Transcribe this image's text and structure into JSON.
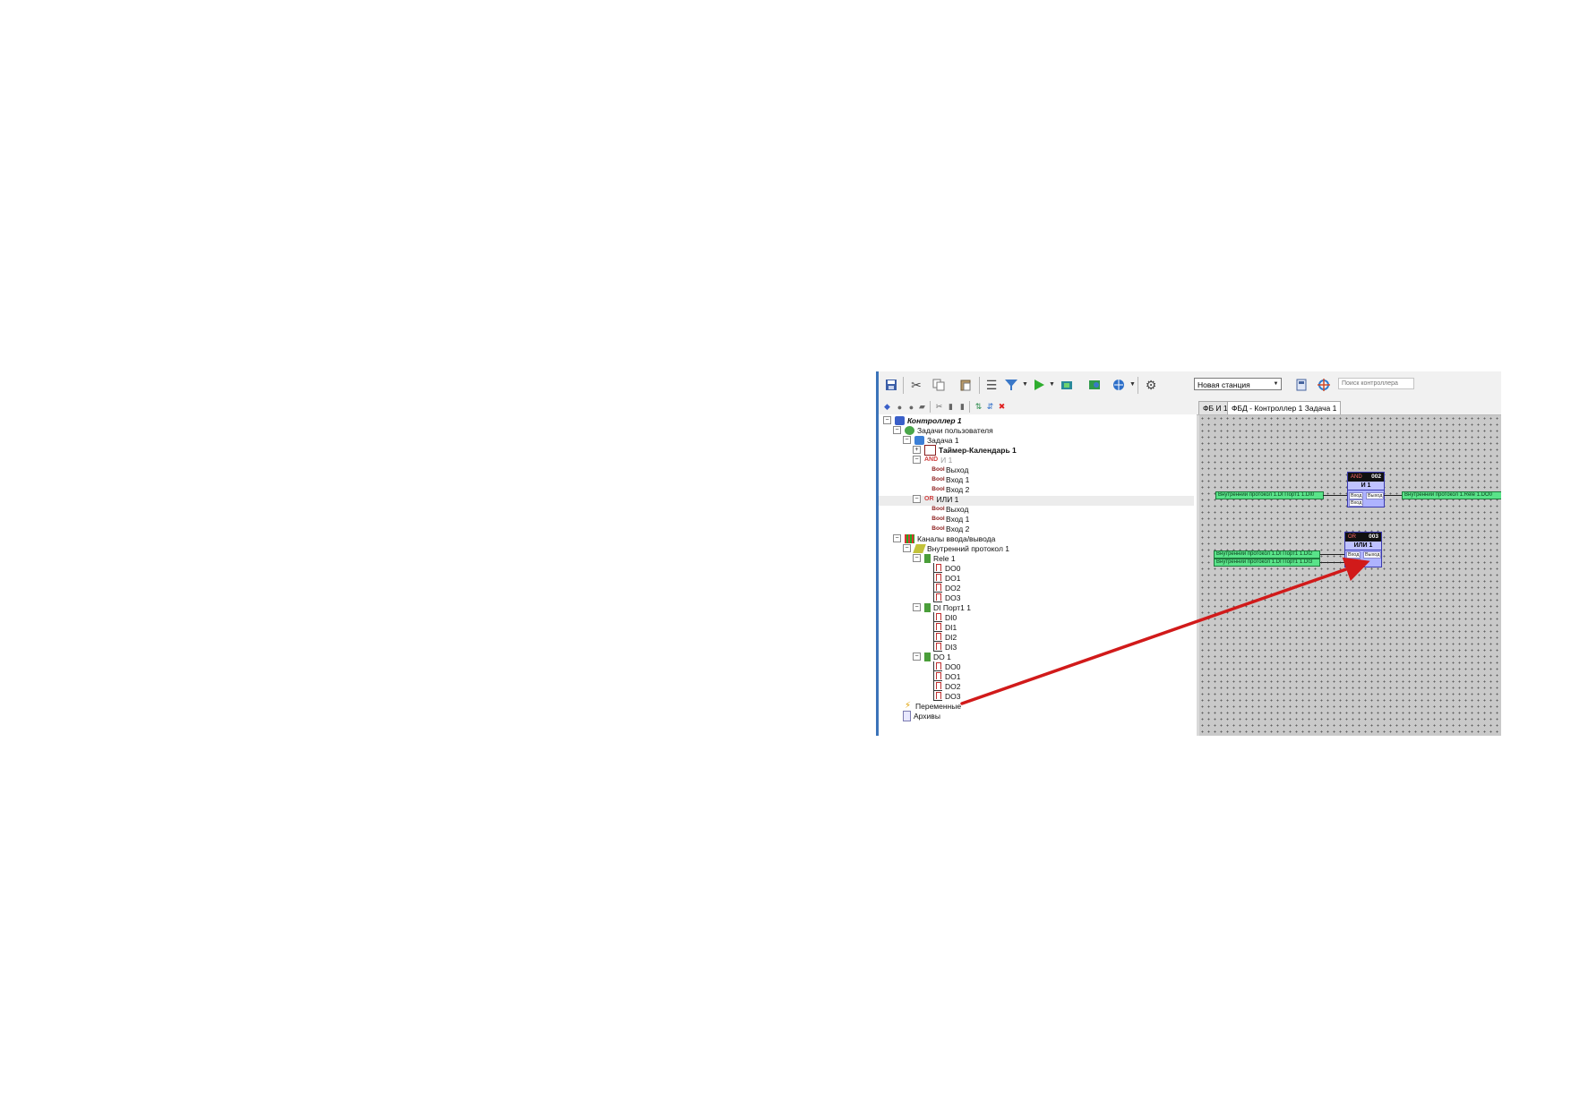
{
  "toolbar": {
    "station_selected": "Новая станция",
    "search_placeholder": "Поиск контроллера"
  },
  "tabs": [
    {
      "label": "ФБ И 1",
      "active": false
    },
    {
      "label": "ФБД - Контроллер 1 Задача 1",
      "active": true
    }
  ],
  "tree": {
    "controller": "Контроллер 1",
    "user_tasks": "Задачи пользователя",
    "task": "Задача 1",
    "timer": "Таймер-Календарь 1",
    "and_block": {
      "label": "И 1",
      "tag": "AND",
      "pins": [
        "Выход",
        "Вход 1",
        "Вход 2"
      ]
    },
    "or_block": {
      "label": "ИЛИ 1",
      "tag": "OR",
      "pins": [
        "Выход",
        "Вход 1",
        "Вход 2"
      ]
    },
    "io_channels": "Каналы ввода/вывода",
    "protocol": "Внутренний протокол 1",
    "rele": {
      "label": "Rele 1",
      "channels": [
        "DO0",
        "DO1",
        "DO2",
        "DO3"
      ]
    },
    "di_port": {
      "label": "DI Порт1 1",
      "channels": [
        "DI0",
        "DI1",
        "DI2",
        "DI3"
      ]
    },
    "do": {
      "label": "DO 1",
      "channels": [
        "DO0",
        "DO1",
        "DO2",
        "DO3"
      ]
    },
    "variables": "Переменные",
    "archives": "Архивы",
    "bool_icon": "Bool"
  },
  "canvas": {
    "and_block": {
      "id": "002",
      "type": "AND",
      "name": "И 1",
      "pin_in": "Вход",
      "pin_in2": "Вход",
      "pin_out": "Выход"
    },
    "or_block": {
      "id": "003",
      "type": "OR",
      "name": "ИЛИ 1",
      "pin_in": "Вход",
      "pin_in2": "Вход",
      "pin_out": "Выход"
    },
    "vars": {
      "and_in": "Внутренний протокол 1.DI Порт1 1.DI0",
      "and_out": "Внутренний протокол 1.Rele 1.DO0",
      "or_in1": "Внутренний протокол 1.DI Порт1 1.DI2",
      "or_in2": "Внутренний протокол 1.DI Порт1 1.DI3"
    }
  },
  "colors": {
    "annotation_arrow": "#d11a1a",
    "var_fill": "#59e389",
    "block_fill": "#aeb3ff",
    "canvas_bg": "#c9c9c9"
  }
}
